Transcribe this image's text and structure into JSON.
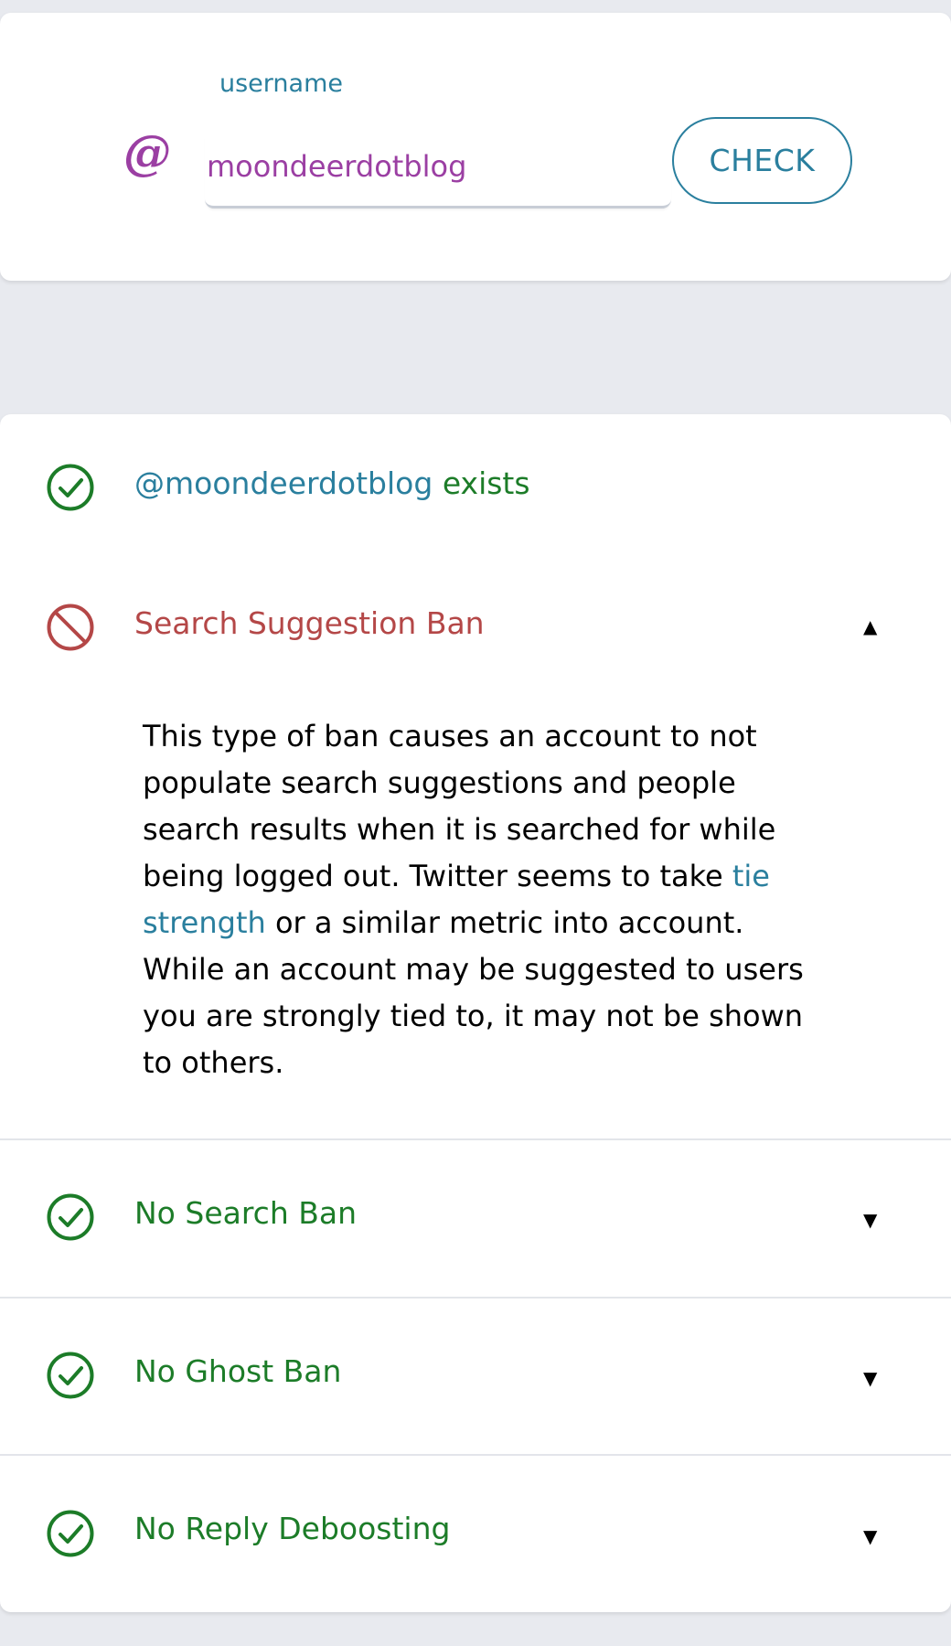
{
  "colors": {
    "accent_blue": "#2a7f9e",
    "username_purple": "#9b3fa3",
    "ok_green": "#1c7c28",
    "ban_red": "#b44747",
    "page_bg": "#e8eaef"
  },
  "search": {
    "at_symbol": "@",
    "field_label": "username",
    "value": "moondeerdotblog",
    "button_label": "CHECK"
  },
  "results": {
    "exists": {
      "icon": "check-circle-icon",
      "handle": "@moondeerdotblog",
      "status_text": "exists"
    },
    "search_suggestion_ban": {
      "icon": "ban-icon",
      "label": "Search Suggestion Ban",
      "expanded": true,
      "caret": "▲",
      "description_before_link": "This type of ban causes an account to not populate search suggestions and people search results when it is searched for while being logged out. Twitter seems to take ",
      "link_text": "tie strength",
      "description_after_link": " or a similar metric into account. While an account may be suggested to users you are strongly tied to, it may not be shown to others."
    },
    "search_ban": {
      "icon": "check-circle-icon",
      "label": "No Search Ban",
      "expanded": false,
      "caret": "▼"
    },
    "ghost_ban": {
      "icon": "check-circle-icon",
      "label": "No Ghost Ban",
      "expanded": false,
      "caret": "▼"
    },
    "reply_deboosting": {
      "icon": "check-circle-icon",
      "label": "No Reply Deboosting",
      "expanded": false,
      "caret": "▼"
    }
  }
}
